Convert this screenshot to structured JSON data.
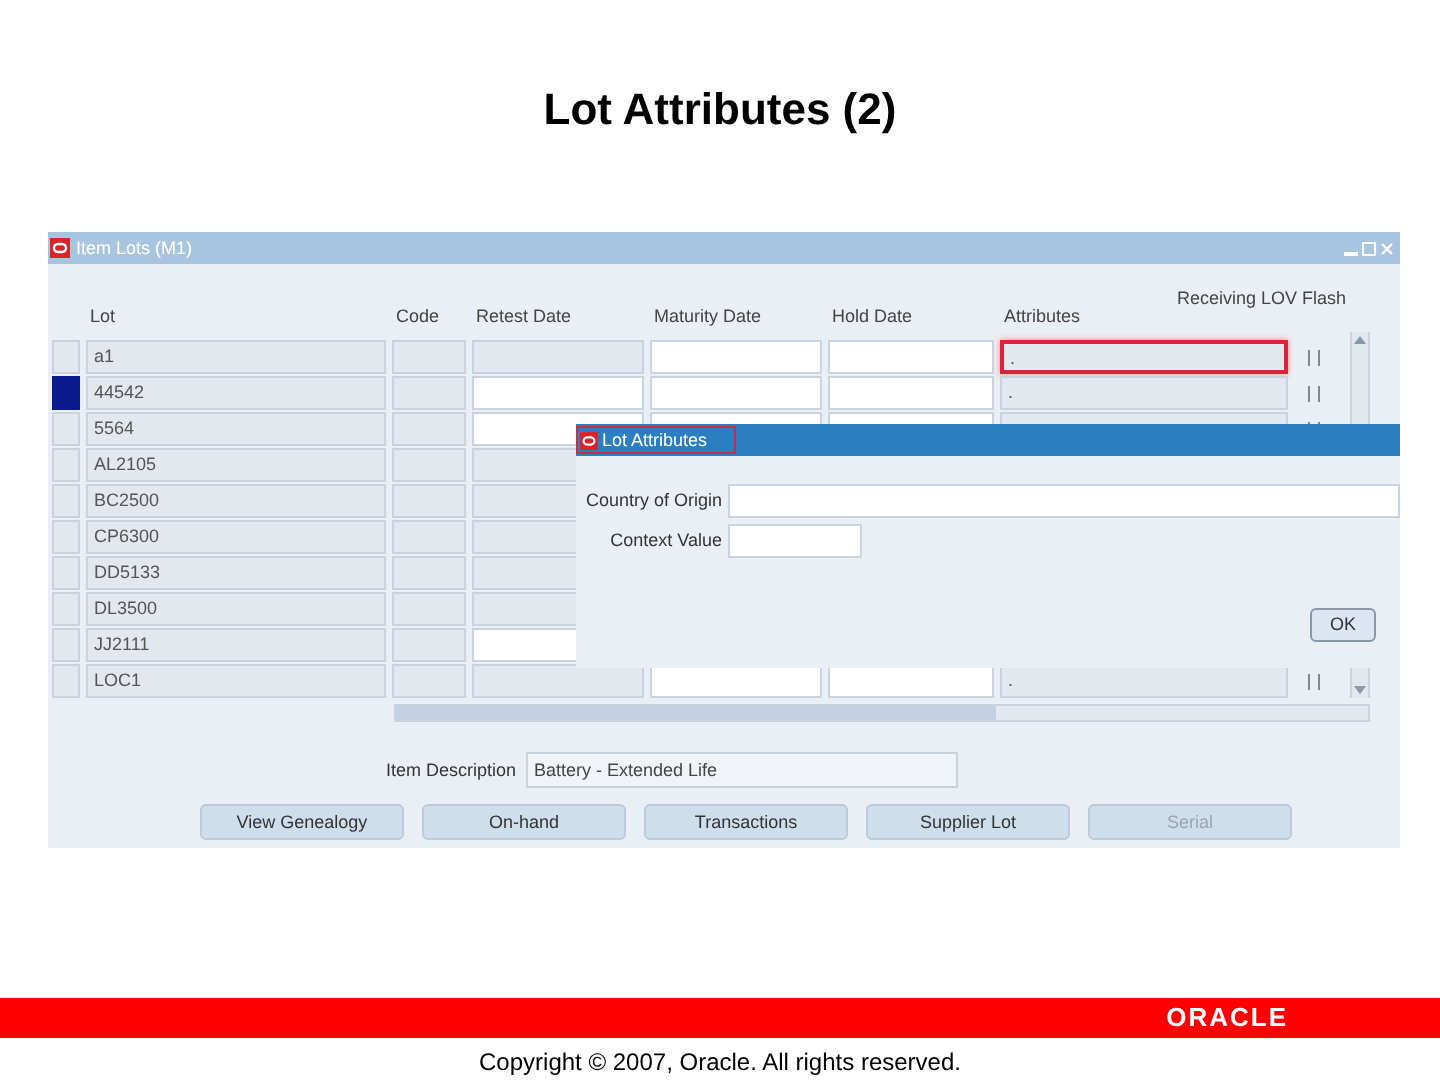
{
  "slide": {
    "title": "Lot Attributes (2)",
    "copyright": "Copyright © 2007, Oracle. All rights reserved.",
    "logo": "ORACLE"
  },
  "window": {
    "title": "Item Lots (M1)",
    "columns": [
      "Lot",
      "Code",
      "Retest Date",
      "Maturity Date",
      "Hold Date",
      "Attributes"
    ],
    "flag_heading": "Receiving LOV Flash",
    "rows": [
      {
        "lot": "a1",
        "attributes": ".",
        "selected": false,
        "editable": false,
        "highlighted": true
      },
      {
        "lot": "44542",
        "attributes": ".",
        "selected": true,
        "editable": true,
        "highlighted": false
      },
      {
        "lot": "5564",
        "selected": false,
        "editable": true
      },
      {
        "lot": "AL2105",
        "selected": false,
        "editable": false
      },
      {
        "lot": "BC2500",
        "selected": false,
        "editable": false
      },
      {
        "lot": "CP6300",
        "selected": false,
        "editable": false
      },
      {
        "lot": "DD5133",
        "selected": false,
        "editable": false
      },
      {
        "lot": "DL3500",
        "selected": false,
        "editable": false
      },
      {
        "lot": "JJ2111",
        "selected": false,
        "editable": true
      },
      {
        "lot": "LOC1",
        "attributes": ".",
        "selected": false,
        "editable": false,
        "highlighted": false
      }
    ],
    "item_description": {
      "label": "Item Description",
      "value": "Battery - Extended Life"
    },
    "buttons": [
      {
        "label": "View Genealogy",
        "disabled": false
      },
      {
        "label": "On-hand",
        "disabled": false
      },
      {
        "label": "Transactions",
        "disabled": false
      },
      {
        "label": "Supplier Lot",
        "disabled": false
      },
      {
        "label": "Serial",
        "disabled": true
      }
    ],
    "dialog": {
      "title": "Lot Attributes",
      "fields": [
        {
          "label": "Country of Origin",
          "kind": "wide"
        },
        {
          "label": "Context Value",
          "kind": "narrow"
        }
      ],
      "ok": "OK"
    }
  }
}
